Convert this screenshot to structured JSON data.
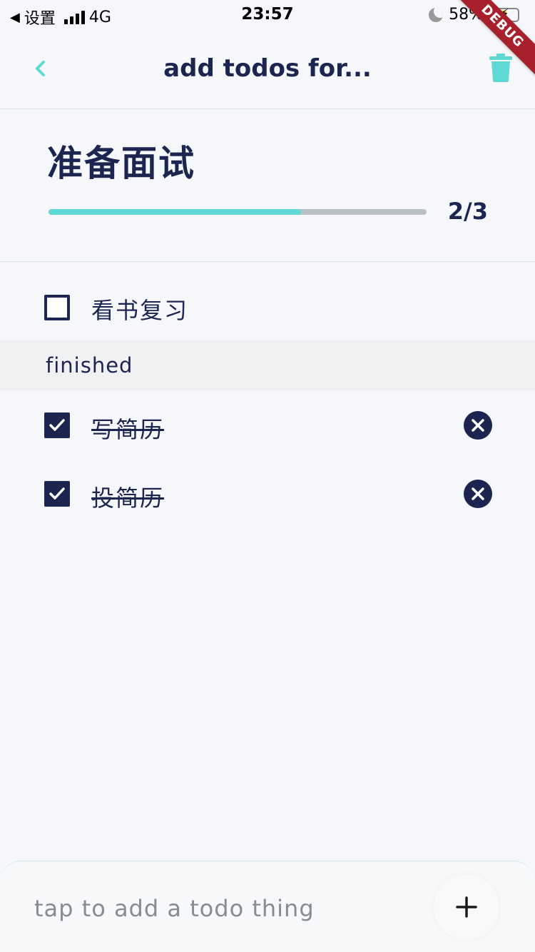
{
  "status_bar": {
    "back_app": "设置",
    "network": "4G",
    "time": "23:57",
    "battery": "58%"
  },
  "debug_banner": "DEBUG",
  "app_bar": {
    "title": "add todos for...",
    "back_icon": "chevron-left-icon",
    "action_icon": "trash-icon",
    "accent_color": "#5fd9d3"
  },
  "todo_list": {
    "title": "准备面试",
    "progress_text": "2/3",
    "progress_fraction": 0.667,
    "progress_color": "#5fd9d3"
  },
  "pending_items": [
    {
      "label": "看书复习",
      "checked": false
    }
  ],
  "finished_section": {
    "label": "finished",
    "items": [
      {
        "label": "写简历",
        "checked": true
      },
      {
        "label": "投简历",
        "checked": true
      }
    ]
  },
  "bottom_input": {
    "placeholder": "tap to add a todo thing",
    "add_icon": "plus-icon"
  },
  "colors": {
    "primary": "#1c2550",
    "background": "#f5f7fa"
  }
}
